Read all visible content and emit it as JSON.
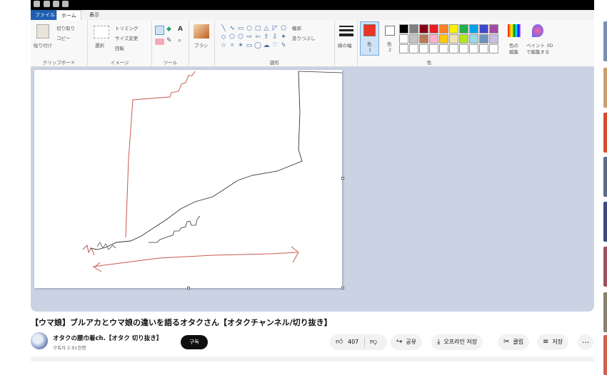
{
  "paint": {
    "tabs": [
      "ファイル",
      "ホーム",
      "表示"
    ],
    "clipboard": {
      "paste_label": "貼り付け",
      "cut_label": "切り取り",
      "copy_label": "コピー",
      "group_label": "クリップボード"
    },
    "image": {
      "select_label": "選択",
      "crop_label": "トリミング",
      "resize_label": "サイズ変更",
      "rotate_label": "回転",
      "group_label": "イメージ"
    },
    "tools": {
      "group_label": "ツール"
    },
    "brushes": {
      "label": "ブラシ"
    },
    "shapes": {
      "outline_label": "輪郭",
      "fill_label": "塗りつぶし",
      "group_label": "図形"
    },
    "size": {
      "label": "線の幅"
    },
    "color1": {
      "label": "色",
      "sub": "1",
      "value": "#ee3322"
    },
    "color2": {
      "label": "色",
      "sub": "2",
      "value": "#ffffff"
    },
    "edit_colors": {
      "label": "色の",
      "label2": "編集"
    },
    "paint3d": {
      "label": "ペイント 3D",
      "label2": "で編集する"
    },
    "colors_group_label": "色",
    "palette": [
      "#000000",
      "#7f7f7f",
      "#880015",
      "#ed1c24",
      "#ff7f27",
      "#fff200",
      "#22b14c",
      "#00a2e8",
      "#3f48cc",
      "#a349a4",
      "#ffffff",
      "#c3c3c3",
      "#b97a57",
      "#ffaec9",
      "#ffc90e",
      "#efe4b0",
      "#b5e61d",
      "#99d9ea",
      "#7092be",
      "#c8bfe7",
      "#ffffff",
      "#ffffff",
      "#ffffff",
      "#ffffff",
      "#ffffff",
      "#ffffff",
      "#ffffff",
      "#ffffff",
      "#ffffff",
      "#ffffff"
    ]
  },
  "video": {
    "title": "【ウマ娘】ブルアカとウマ娘の違いを語るオタクさん【オタクチャンネル/切り抜き】",
    "channel": "オタクの腰巾着ch.【オタク 切り抜き】",
    "subscribers": "구독자 2.91천명",
    "subscribe_label": "구독",
    "likes": "407",
    "share_label": "공유",
    "offline_label": "오프라인 저장",
    "clip_label": "클립",
    "save_label": "저장",
    "more_label": "…"
  }
}
